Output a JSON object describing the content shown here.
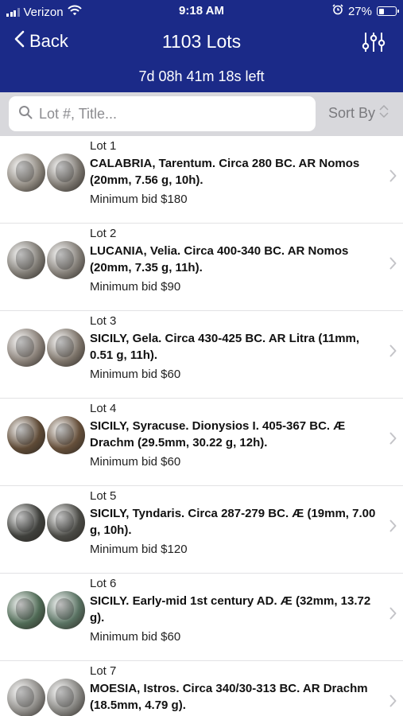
{
  "status_bar": {
    "carrier": "Verizon",
    "time": "9:18 AM",
    "battery": "27%"
  },
  "nav": {
    "back_label": "Back",
    "title": "1103 Lots",
    "time_left": "7d 08h 41m 18s left"
  },
  "search": {
    "placeholder": "Lot #, Title...",
    "sort_label": "Sort By"
  },
  "colors": {
    "header": "#1b2a88",
    "search_bar_bg": "#d8d8dc",
    "divider": "#e2e2e4"
  },
  "lots": [
    {
      "number": "Lot 1",
      "title": "CALABRIA, Tarentum. Circa 280 BC. AR Nomos (20mm, 7.56 g, 10h).",
      "bid": "Minimum bid $180",
      "coin_colors": [
        "#8d877e",
        "#7b766f"
      ]
    },
    {
      "number": "Lot 2",
      "title": "LUCANIA, Velia. Circa 400-340 BC. AR Nomos (20mm, 7.35 g, 11h).",
      "bid": "Minimum bid $90",
      "coin_colors": [
        "#7e7a73",
        "#827d76"
      ]
    },
    {
      "number": "Lot 3",
      "title": "SICILY, Gela. Circa 430-425 BC. AR Litra (11mm, 0.51 g, 11h).",
      "bid": "Minimum bid $60",
      "coin_colors": [
        "#8a8179",
        "#7d746a"
      ]
    },
    {
      "number": "Lot 4",
      "title": "SICILY, Syracuse. Dionysios I. 405-367 BC. Æ Drachm (29.5mm, 30.22 g, 12h).",
      "bid": "Minimum bid $60",
      "coin_colors": [
        "#5e4a36",
        "#654f3a"
      ]
    },
    {
      "number": "Lot 5",
      "title": "SICILY, Tyndaris. Circa 287-279 BC. Æ (19mm, 7.00 g, 10h).",
      "bid": "Minimum bid $120",
      "coin_colors": [
        "#3f403c",
        "#4a4a45"
      ]
    },
    {
      "number": "Lot 6",
      "title": "SICILY. Early-mid 1st century AD. Æ (32mm, 13.72 g).",
      "bid": "Minimum bid $60",
      "coin_colors": [
        "#4f6a55",
        "#587161"
      ]
    },
    {
      "number": "Lot 7",
      "title": "MOESIA, Istros. Circa 340/30-313 BC. AR Drachm (18.5mm, 4.79 g).",
      "bid": "",
      "coin_colors": [
        "#8e8c88",
        "#858480"
      ]
    }
  ]
}
